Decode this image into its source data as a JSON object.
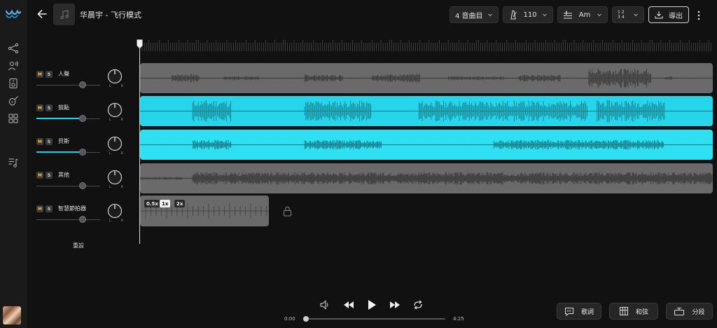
{
  "header": {
    "song_title": "华晨宇 - 飞行模式",
    "tracks_select": "4 音曲目",
    "tempo": "110",
    "key": "Am",
    "time_signature_top": "1 2",
    "time_signature_bottom": "3 4",
    "export_label": "導出"
  },
  "tracks": [
    {
      "name": "人聲",
      "mute": "M",
      "solo": "S",
      "volume": 0.72,
      "active": false
    },
    {
      "name": "鼓點",
      "mute": "M",
      "solo": "S",
      "volume": 0.72,
      "active": true
    },
    {
      "name": "貝斯",
      "mute": "M",
      "solo": "S",
      "volume": 0.72,
      "active": true
    },
    {
      "name": "其他",
      "mute": "M",
      "solo": "S",
      "volume": 0.72,
      "active": false
    },
    {
      "name": "智慧節拍器",
      "mute": "M",
      "solo": "S",
      "volume": 0.72,
      "active": false
    }
  ],
  "reset_label": "重設",
  "metronome": {
    "speeds": [
      "0.5x",
      "1x",
      "2x"
    ],
    "selected": "1x"
  },
  "transport": {
    "current_time": "0:00",
    "total_time": "4:25",
    "progress": 0
  },
  "bottom_buttons": {
    "lyrics": "歌詞",
    "chords": "和弦",
    "sections": "分段"
  },
  "colors": {
    "accent": "#26d5ea",
    "lane_gray": "#6a6a6a",
    "background": "#111111"
  },
  "icons": [
    "logo-icon",
    "share-icon",
    "voice-icon",
    "speaker-icon",
    "guitar-icon",
    "grid-icon",
    "playlist-icon",
    "back-icon",
    "music-note-icon",
    "metronome-icon",
    "tuner-icon",
    "chevron-down-icon",
    "export-icon",
    "more-icon",
    "lock-icon",
    "volume-icon",
    "rewind-icon",
    "play-icon",
    "forward-icon",
    "loop-icon",
    "lyrics-icon",
    "chords-icon",
    "sections-icon"
  ]
}
